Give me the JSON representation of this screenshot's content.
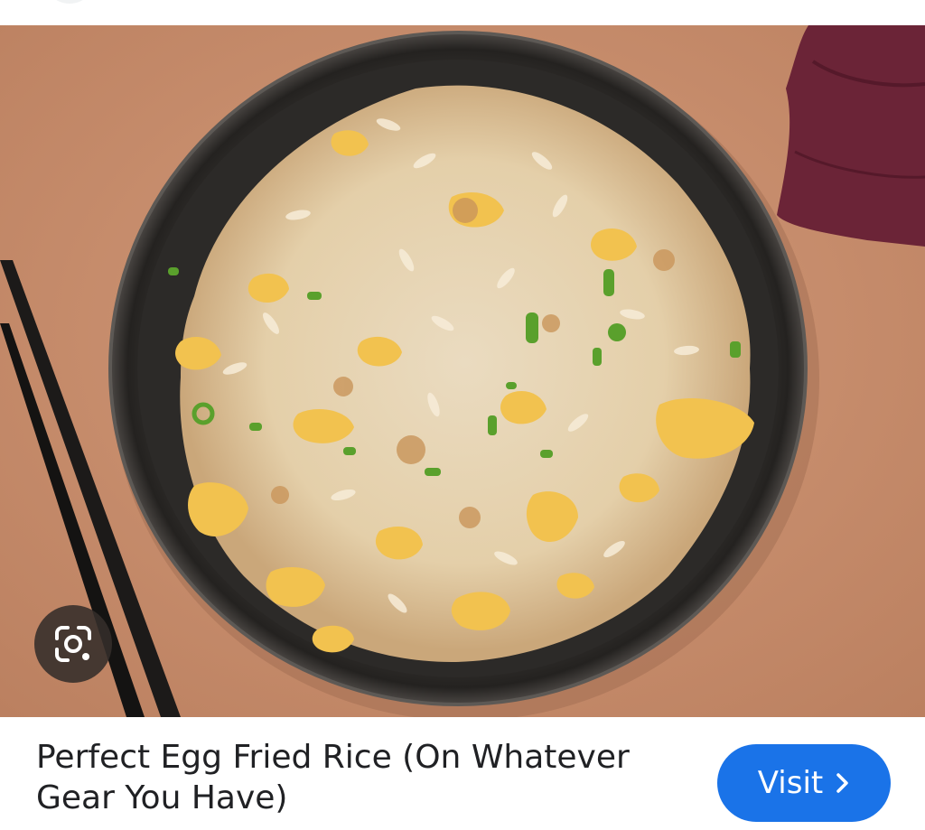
{
  "result": {
    "image": {
      "subject": "Bowl of egg fried rice with scallions, chopsticks and a napkin",
      "colors": {
        "background": "#c98f6f",
        "bowl": "#2f2d2b",
        "rice": "#e8d6b8",
        "egg": "#f2c24f",
        "scallion": "#5aa02c",
        "napkin": "#6b2437",
        "chopsticks": "#1c1a19"
      }
    },
    "lens_button": {
      "icon": "google-lens-icon"
    },
    "title": "Perfect Egg Fried Rice (On Whatever Gear You Have)",
    "visit_button": {
      "label": "Visit",
      "icon": "chevron-right-icon",
      "color": "#1a73e8"
    }
  }
}
